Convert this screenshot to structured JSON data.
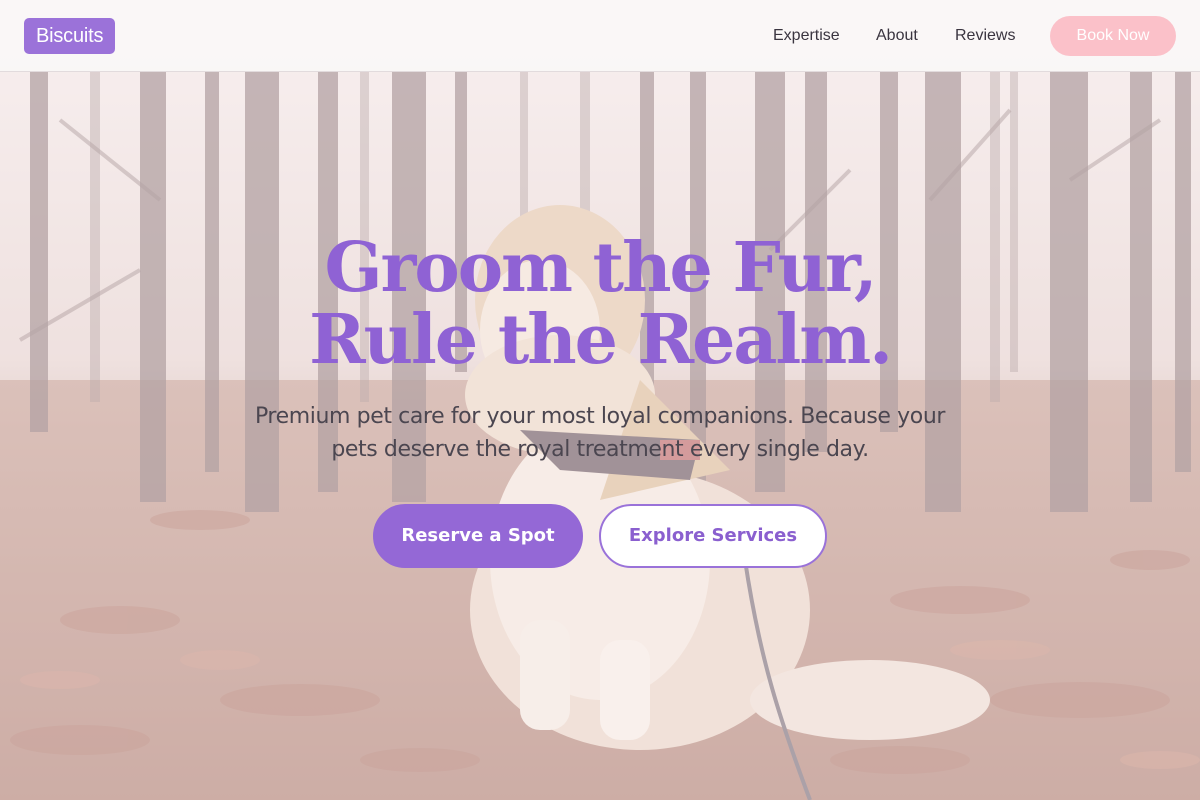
{
  "brand": {
    "logo_text": "Biscuits",
    "accent_color": "#9b72d9",
    "cta_pink": "#fbc1c9"
  },
  "nav": {
    "items": [
      {
        "label": "Expertise"
      },
      {
        "label": "About"
      },
      {
        "label": "Reviews"
      }
    ],
    "book_label": "Book Now"
  },
  "hero": {
    "headline_line1": "Groom the Fur,",
    "headline_line2": "Rule the Realm.",
    "subtitle": "Premium pet care for your most loyal companions. Because your pets deserve the royal treatment every single day.",
    "primary_cta": "Reserve a Spot",
    "secondary_cta": "Explore Services",
    "background_image": "dog-in-autumn-forest"
  }
}
